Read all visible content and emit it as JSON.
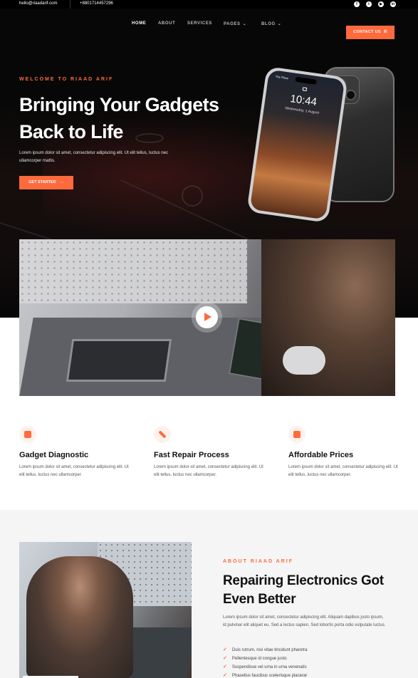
{
  "topbar": {
    "email": "hello@riaadarif.com",
    "phone": "+8801714457296",
    "social_icons": [
      "facebook-icon",
      "twitter-icon",
      "youtube-icon",
      "linkedin-icon"
    ]
  },
  "nav": {
    "items": [
      {
        "label": "HOME",
        "active": true
      },
      {
        "label": "ABOUT",
        "active": false
      },
      {
        "label": "SERVICES",
        "active": false
      },
      {
        "label": "PAGES",
        "active": false,
        "dropdown": true
      },
      {
        "label": "BLOG",
        "active": false,
        "dropdown": true
      }
    ],
    "contact_label": "CONTACT US"
  },
  "hero": {
    "welcome": "WELCOME TO RIAAD ARIF",
    "title_line1": "Bringing Your Gadgets",
    "title_line2": "Back to Life",
    "desc": "Lorem ipsum dolor sit amet, consectetur adipiscing elit. Ut elit tellus, luctus nec ullamcorper mattis.",
    "cta_label": "GET STARTED",
    "phone_time": "10:44",
    "phone_date": "Wednesday, 1 August",
    "phone_carrier": "The Place"
  },
  "features": [
    {
      "title": "Gadget Diagnostic",
      "desc": "Lorem ipsum dolor sit amet, consectetur adipiscing elit. Ut elit tellus, luctus nec ullamcorper."
    },
    {
      "title": "Fast Repair Process",
      "desc": "Lorem ipsum dolor sit amet, consectetur adipiscing elit. Ut elit tellus, luctus nec ullamcorper."
    },
    {
      "title": "Affordable Prices",
      "desc": "Lorem ipsum dolor sit amet, consectetur adipiscing elit. Ut elit tellus, luctus nec ullamcorper."
    }
  ],
  "about": {
    "subtitle": "ABOUT RIAAD ARIF",
    "title_line1": "Repairing Electronics Got",
    "title_line2": "Even Better",
    "desc": "Lorem ipsum dolor sit amet, consectetur adipiscing elit. Aliquam dapibus justo ipsum, id pulvinar elit aliquet eu. Sed a lectus sapien. Sed lobortis porta odio vulputate luctus.",
    "checklist": [
      "Duis rutrum, nisi vitae tincidunt pharetra",
      "Pellentesque id congue justo",
      "Suspendisse vel urna in urna venenatis",
      "Phasellus faucibus scelerisque placerat"
    ]
  },
  "colors": {
    "accent": "#ff6a3d",
    "hero_bg": "#070707",
    "about_bg": "#f5f5f5"
  }
}
